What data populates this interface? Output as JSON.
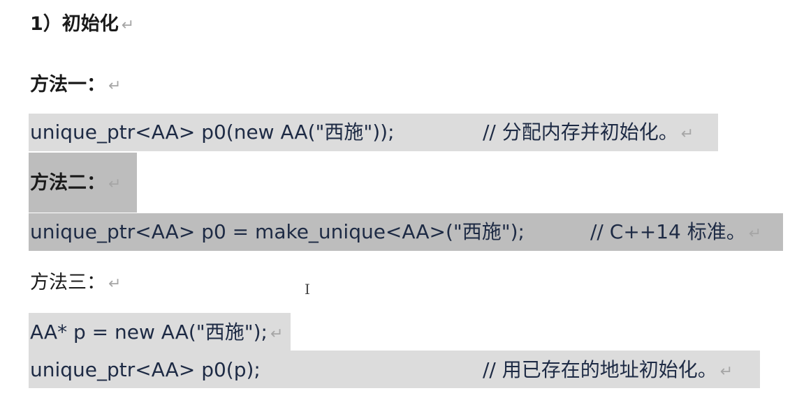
{
  "heading": "1）初始化",
  "paragraph_mark": "↵",
  "method1": {
    "label": "方法一：",
    "code": "unique_ptr<AA> p0(new AA(\"西施\"));",
    "comment": "// 分配内存并初始化。"
  },
  "method2": {
    "label": "方法二：",
    "code": "unique_ptr<AA> p0 = make_unique<AA>(\"西施\");",
    "comment": "// C++14 标准。"
  },
  "method3": {
    "label": "方法三：",
    "code_line1": "AA* p = new AA(\"西施\");",
    "code_line2": "unique_ptr<AA> p0(p);",
    "comment": "// 用已存在的地址初始化。"
  },
  "text_cursor": "I",
  "colors": {
    "highlight": "#dcdcdc",
    "highlight_selected": "#bdbdbd",
    "code_text": "#1d2a44",
    "paragraph_mark": "#a6a6a6"
  }
}
